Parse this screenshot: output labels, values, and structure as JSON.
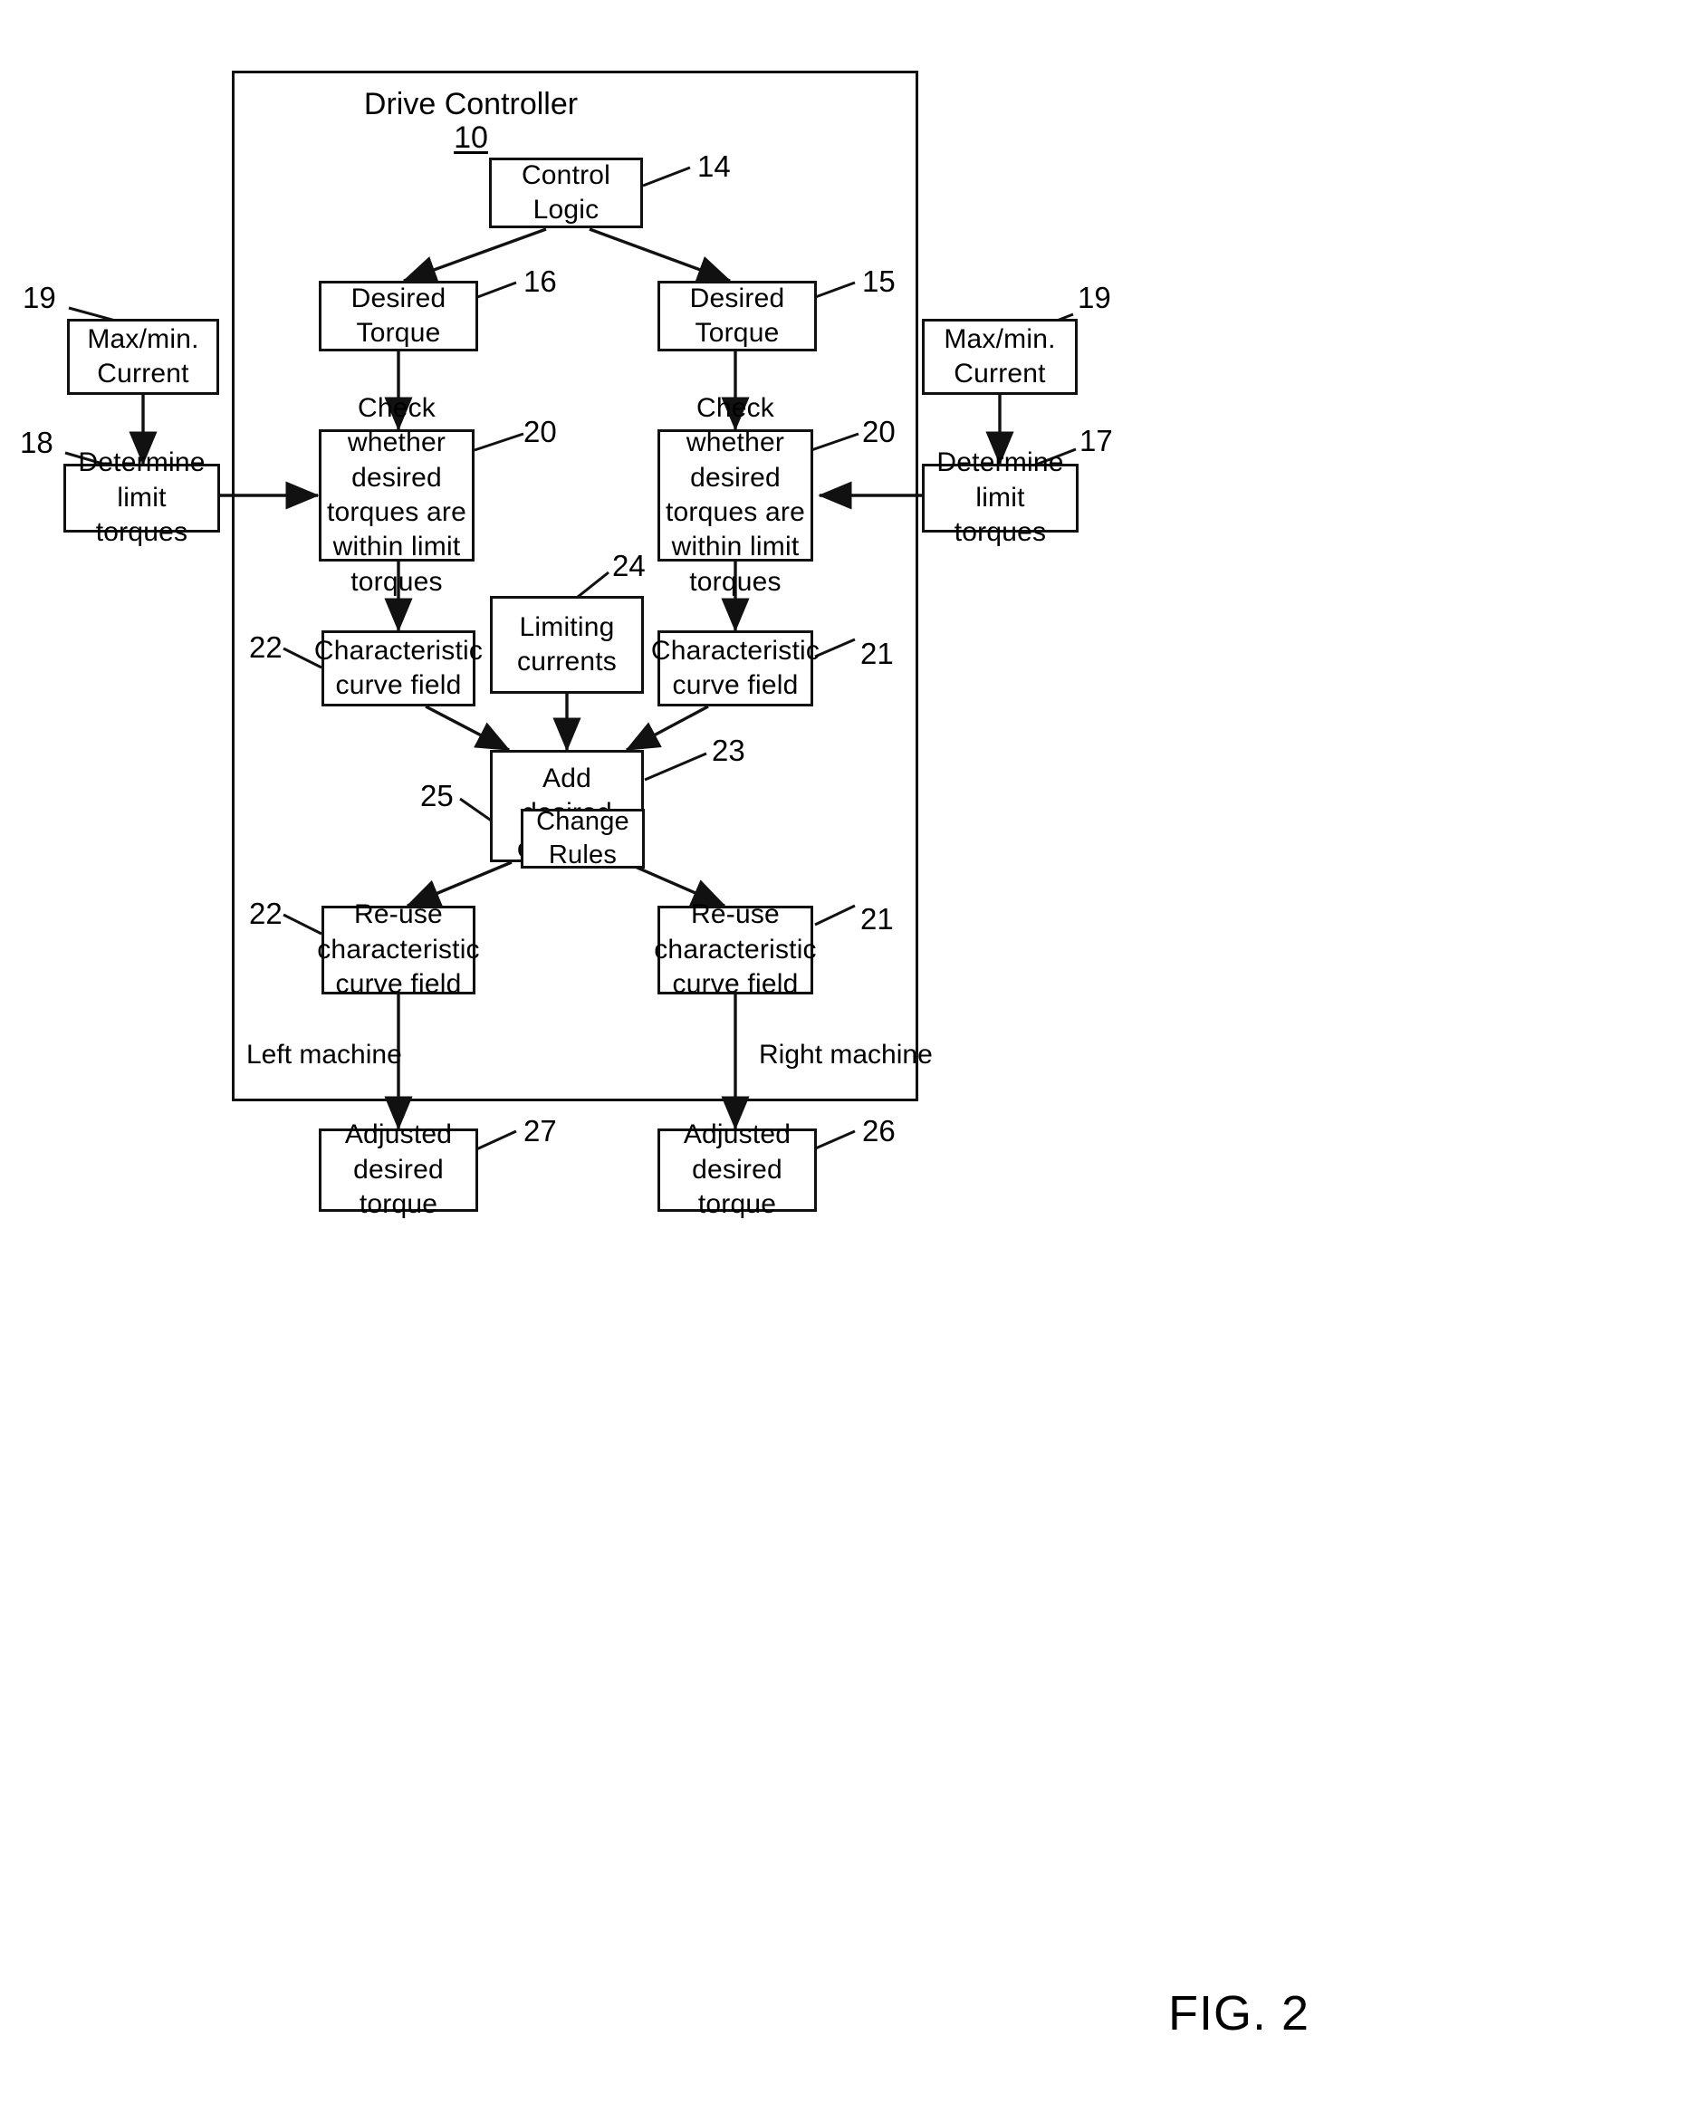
{
  "figure": {
    "caption": "FIG. 2"
  },
  "controller": {
    "title": "Drive Controller",
    "ref": "10"
  },
  "side_labels": {
    "left": "Left machine",
    "right": "Right machine"
  },
  "nodes": {
    "control_logic": {
      "label": "Control Logic",
      "ref": "14"
    },
    "desired_torque_left": {
      "label": "Desired\nTorque",
      "ref": "16"
    },
    "desired_torque_right": {
      "label": "Desired\nTorque",
      "ref": "15"
    },
    "maxmin_current_left": {
      "label": "Max/min.\nCurrent",
      "ref": "19"
    },
    "maxmin_current_right": {
      "label": "Max/min.\nCurrent",
      "ref": "19"
    },
    "determine_limit_left": {
      "label": "Determine limit\ntorques",
      "ref": "18"
    },
    "determine_limit_right": {
      "label": "Determine limit\ntorques",
      "ref": "17"
    },
    "check_left": {
      "label": "Check whether\ndesired\ntorques are\nwithin limit\ntorques",
      "ref": "20"
    },
    "check_right": {
      "label": "Check whether\ndesired\ntorques are\nwithin limit\ntorques",
      "ref": "20"
    },
    "curve_field_left": {
      "label": "Characteristic\ncurve field",
      "ref": "22"
    },
    "curve_field_right": {
      "label": "Characteristic\ncurve field",
      "ref": "21"
    },
    "limiting_currents": {
      "label": "Limiting\ncurrents",
      "ref": "24"
    },
    "add_currents": {
      "label": "Add desired\ncurrents",
      "ref": "23"
    },
    "change_rules": {
      "label": "Change\nRules",
      "ref": "25"
    },
    "reuse_left": {
      "label": "Re-use\ncharacteristic\ncurve field",
      "ref": "22"
    },
    "reuse_right": {
      "label": "Re-use\ncharacteristic\ncurve field",
      "ref": "21"
    },
    "adjusted_left": {
      "label": "Adjusted\ndesired torque",
      "ref": "27"
    },
    "adjusted_right": {
      "label": "Adjusted\ndesired torque",
      "ref": "26"
    }
  },
  "colors": {
    "ink": "#111111",
    "paper": "#ffffff"
  }
}
